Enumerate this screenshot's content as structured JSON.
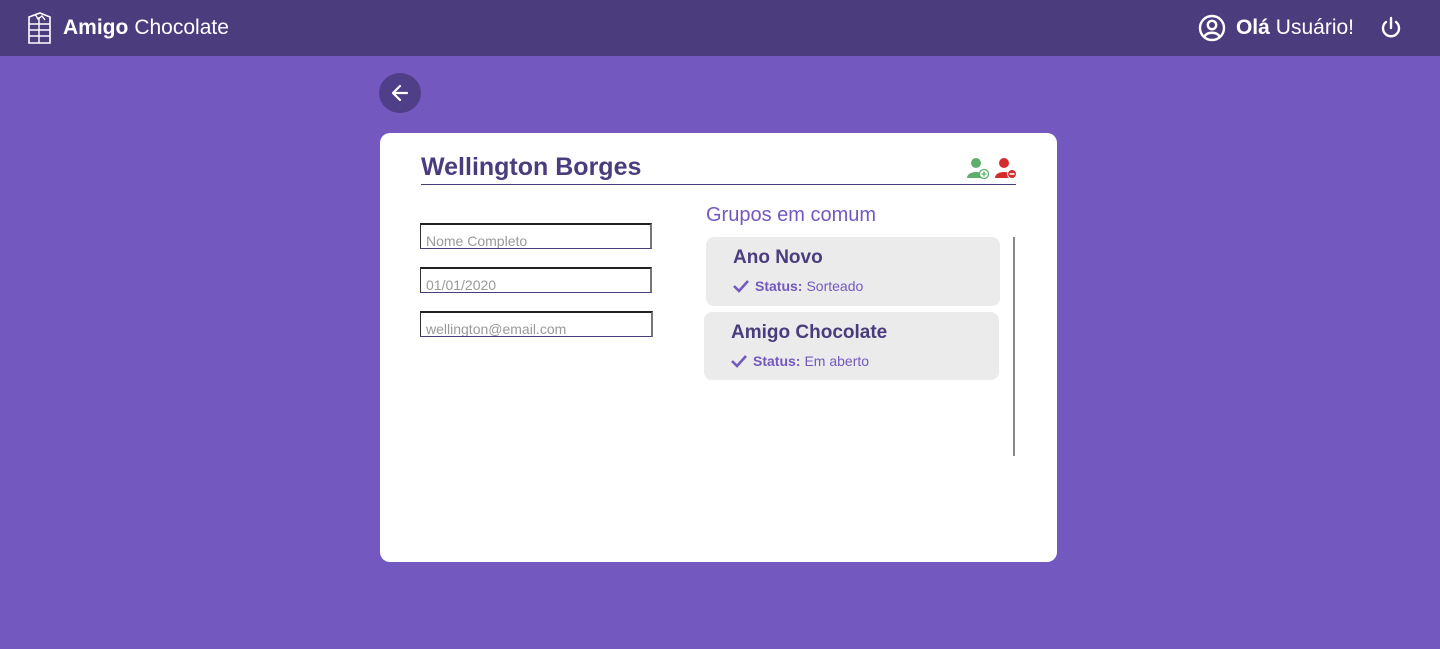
{
  "header": {
    "brand_bold": "Amigo",
    "brand_light": "Chocolate",
    "greeting_bold": "Olá",
    "greeting_name": "Usuário!",
    "logo_icon": "chocolate-bar-icon",
    "user_icon": "user-circle-icon",
    "power_icon": "power-icon"
  },
  "back": {
    "icon": "arrow-left-icon"
  },
  "profile": {
    "name": "Wellington Borges",
    "add_icon": "add-friend-icon",
    "remove_icon": "remove-friend-icon",
    "fields": {
      "full_name_placeholder": "Nome Completo",
      "birthdate_placeholder": "01/01/2020",
      "email_placeholder": "wellington@email.com"
    }
  },
  "groups": {
    "title": "Grupos em comum",
    "status_label": "Status:",
    "items": [
      {
        "name": "Ano Novo",
        "status": "Sorteado"
      },
      {
        "name": "Amigo Chocolate",
        "status": "Em aberto"
      }
    ]
  },
  "colors": {
    "background": "#7358c0",
    "topbar": "#4b3c7e",
    "accent": "#7358c0",
    "add_green": "#5fae6e",
    "remove_red": "#d62b2b"
  }
}
